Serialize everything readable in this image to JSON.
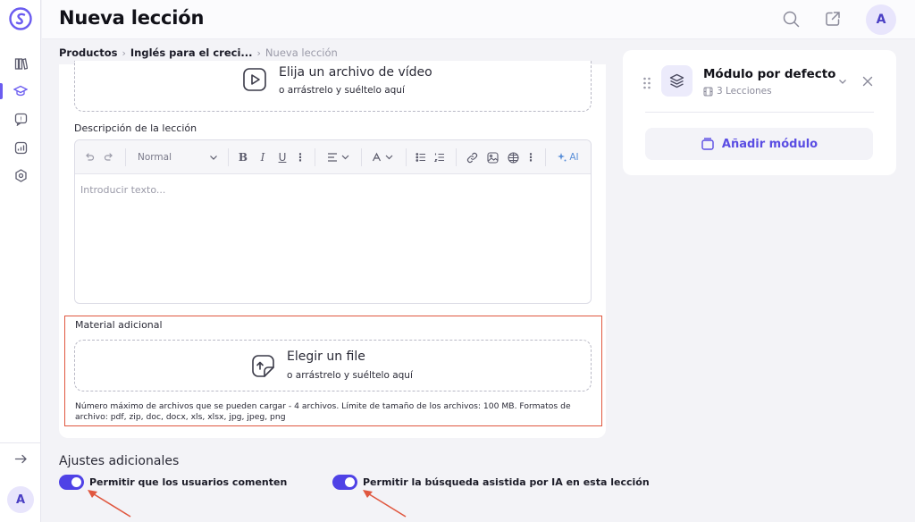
{
  "header": {
    "title": "Nueva lección",
    "avatar_initial": "A",
    "icons": [
      "search-icon",
      "external-link-icon"
    ]
  },
  "breadcrumb": {
    "items": [
      "Productos",
      "Inglés para el creci...",
      "Nueva lección"
    ]
  },
  "sidebar": {
    "icons": [
      "books-icon",
      "graduation-cap-icon",
      "chat-question-icon",
      "analytics-icon",
      "settings-hex-icon"
    ],
    "collapse_icon": "arrow-right-icon",
    "avatar_initial": "A"
  },
  "video_upload": {
    "title": "Elija un archivo de vídeo",
    "subtitle": "o arrástrelo y suéltelo aquí"
  },
  "description": {
    "label": "Descripción de la lección",
    "placeholder": "Introducir texto...",
    "toolbar": {
      "style_label": "Normal",
      "ai_label": "AI"
    }
  },
  "material": {
    "label": "Material adicional",
    "title": "Elegir un file",
    "subtitle": "o arrástrelo y suéltelo aquí",
    "note": "Número máximo de archivos que se pueden cargar - 4 archivos. Límite de tamaño de los archivos: 100 MB. Formatos de archivo: pdf, zip, doc, docx, xls, xlsx, jpg, jpeg, png"
  },
  "module": {
    "name": "Módulo por defecto",
    "lessons": "3 Lecciones",
    "add_label": "Añadir módulo"
  },
  "settings": {
    "title": "Ajustes adicionales",
    "toggles": [
      {
        "label": "Permitir que los usuarios comenten",
        "on": true
      },
      {
        "label": "Permitir la búsqueda asistida por IA en esta lección",
        "on": true
      }
    ]
  },
  "colors": {
    "accent": "#4f42e6",
    "highlight": "#e0573f",
    "background": "#f3f3f7"
  }
}
